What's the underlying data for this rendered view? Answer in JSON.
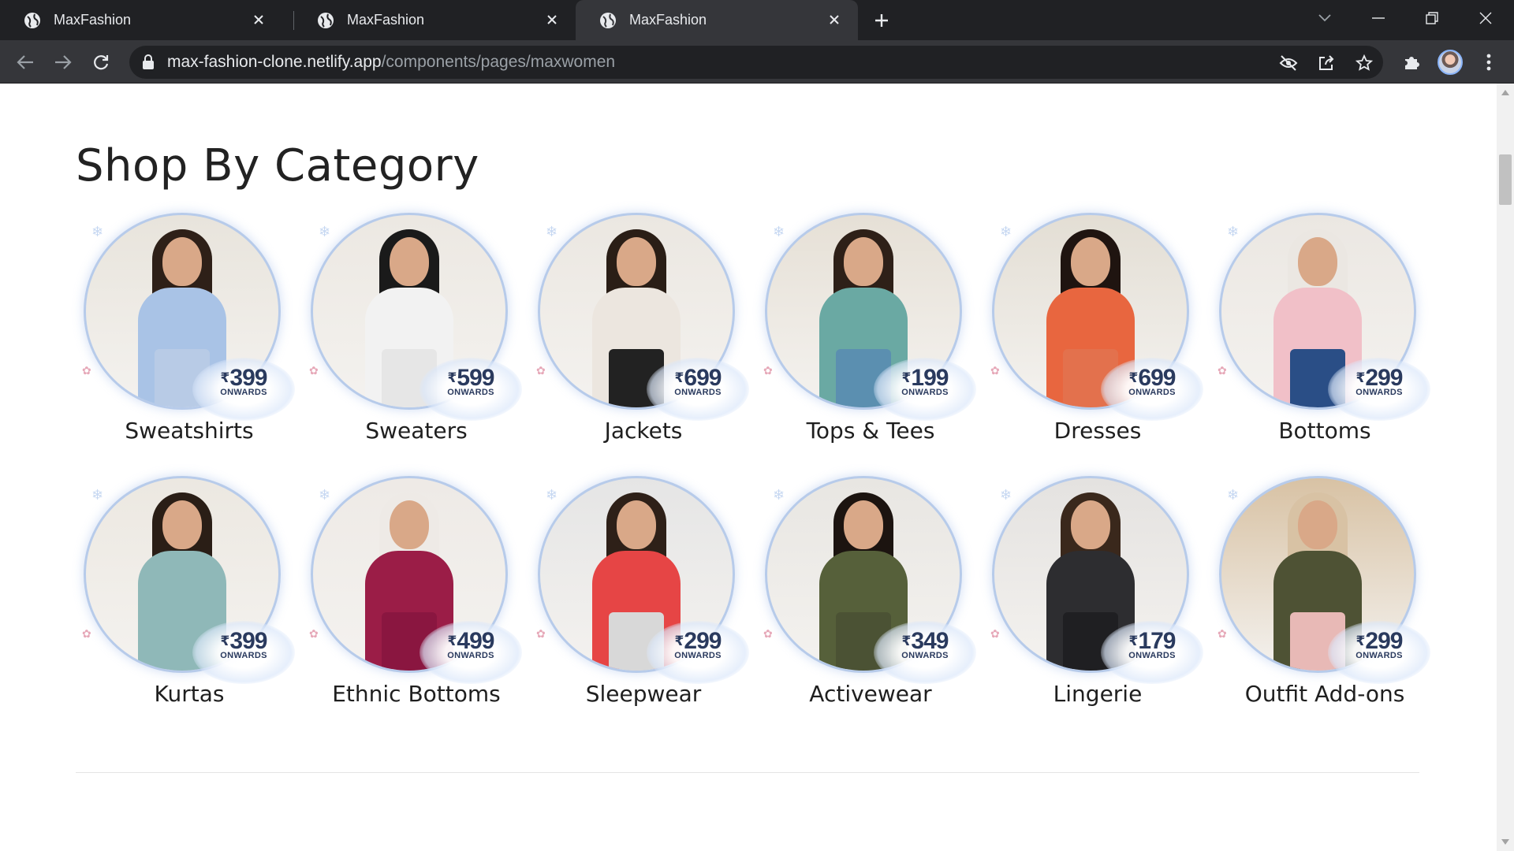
{
  "browser": {
    "tabs": [
      {
        "title": "MaxFashion",
        "active": false
      },
      {
        "title": "MaxFashion",
        "active": false
      },
      {
        "title": "MaxFashion",
        "active": true
      }
    ],
    "url_host": "max-fashion-clone.netlify.app",
    "url_path": "/components/pages/maxwomen"
  },
  "page": {
    "section_title": "Shop By Category",
    "categories": [
      {
        "label": "Sweatshirts",
        "price": "399",
        "price_note": "ONWARDS",
        "bg": "#e8e4dc",
        "top": "#a9c3e6",
        "bottom": "#b8cbe6",
        "hair": "#2e2018"
      },
      {
        "label": "Sweaters",
        "price": "599",
        "price_note": "ONWARDS",
        "bg": "#ece8e2",
        "top": "#f2f2f2",
        "bottom": "#e6e6e6",
        "hair": "#1a1a1a"
      },
      {
        "label": "Jackets",
        "price": "699",
        "price_note": "ONWARDS",
        "bg": "#ebe7e1",
        "top": "#ece6df",
        "bottom": "#222222",
        "hair": "#2a1e16"
      },
      {
        "label": "Tops & Tees",
        "price": "199",
        "price_note": "ONWARDS",
        "bg": "#e6e0d6",
        "top": "#6aa9a3",
        "bottom": "#5b8fb0",
        "hair": "#2e2018"
      },
      {
        "label": "Dresses",
        "price": "699",
        "price_note": "ONWARDS",
        "bg": "#e3ded4",
        "top": "#e8663f",
        "bottom": "#e3714d",
        "hair": "#1f1410"
      },
      {
        "label": "Bottoms",
        "price": "299",
        "price_note": "ONWARDS",
        "bg": "#ebe7e2",
        "top": "#f1c0c8",
        "bottom": "#2a4e86",
        "hair": "#ebe7e2"
      },
      {
        "label": "Kurtas",
        "price": "399",
        "price_note": "ONWARDS",
        "bg": "#ece8e1",
        "top": "#8fb8b8",
        "bottom": "#8fb8b8",
        "hair": "#2a1e16"
      },
      {
        "label": "Ethnic Bottoms",
        "price": "499",
        "price_note": "ONWARDS",
        "bg": "#eeeae6",
        "top": "#9b1d47",
        "bottom": "#8a1640",
        "hair": "#eeeae6"
      },
      {
        "label": "Sleepwear",
        "price": "299",
        "price_note": "ONWARDS",
        "bg": "#e5e5e5",
        "top": "#e64545",
        "bottom": "#d8d8d8",
        "hair": "#2e2018"
      },
      {
        "label": "Activewear",
        "price": "349",
        "price_note": "ONWARDS",
        "bg": "#e8e6e2",
        "top": "#56603a",
        "bottom": "#4b5234",
        "hair": "#1c1410"
      },
      {
        "label": "Lingerie",
        "price": "179",
        "price_note": "ONWARDS",
        "bg": "#e4e2e0",
        "top": "#2d2d30",
        "bottom": "#1f1f22",
        "hair": "#3a281c"
      },
      {
        "label": "Outfit Add-ons",
        "price": "299",
        "price_note": "ONWARDS",
        "bg": "#d8c2a4",
        "top": "#4e5234",
        "bottom": "#e8b9b6",
        "hair": "#d8c2a4"
      }
    ]
  },
  "icons": {
    "tab_icon": "globe-icon",
    "close": "close-icon",
    "new_tab": "plus-icon",
    "back": "arrow-left-icon",
    "forward": "arrow-right-icon",
    "reload": "reload-icon",
    "lock": "lock-icon",
    "eye_off": "eye-off-icon",
    "share": "share-icon",
    "bookmark": "star-icon",
    "extensions": "puzzle-icon",
    "menu": "kebab-menu-icon"
  }
}
